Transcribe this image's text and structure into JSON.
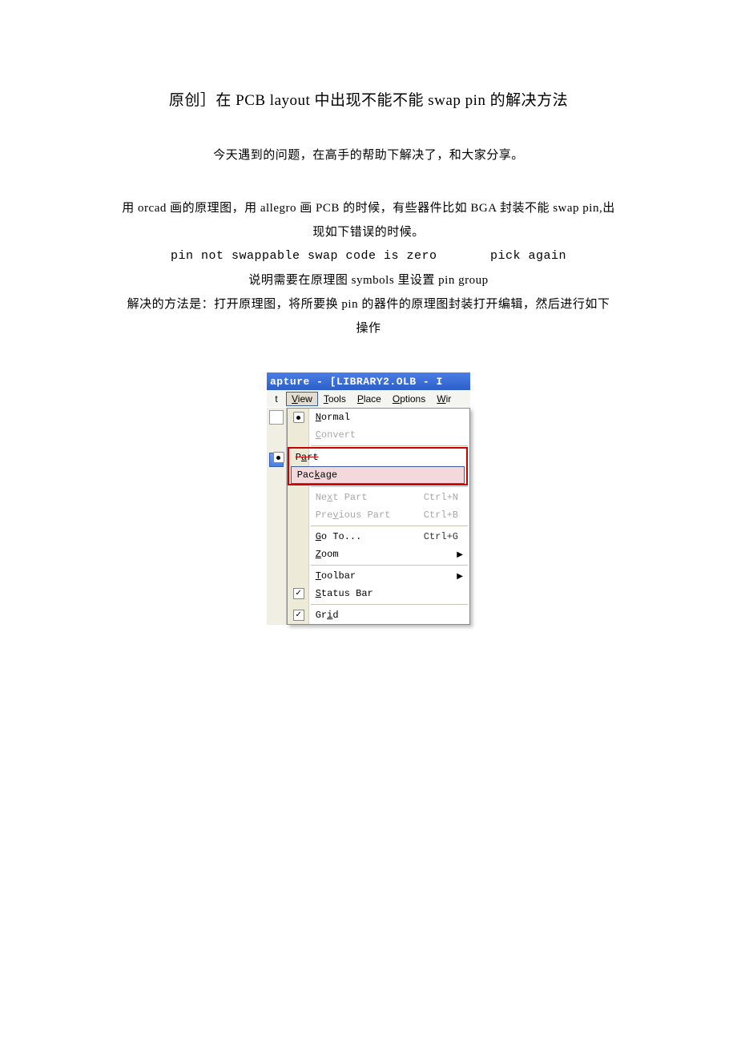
{
  "document": {
    "title": "原创］在 PCB layout 中出现不能不能 swap pin 的解决方法",
    "intro": "今天遇到的问题，在高手的帮助下解决了，和大家分享。",
    "p1_line1": "用 orcad 画的原理图，用 allegro 画 PCB 的时候，有些器件比如 BGA 封装不能 swap pin,出",
    "p1_line2": "现如下错误的时候。",
    "error_text": "pin not swappable swap code is zero       pick again",
    "p2": "说明需要在原理图 symbols 里设置 pin group",
    "p3_line1": "解决的方法是：打开原理图，将所要换 pin 的器件的原理图封装打开编辑，然后进行如下",
    "p3_line2": "操作"
  },
  "screenshot": {
    "titlebar": "apture - [LIBRARY2.OLB - I",
    "menubar": {
      "left": "t",
      "items": [
        "View",
        "Tools",
        "Place",
        "Options",
        "Wir"
      ]
    },
    "menu": {
      "normal": "Normal",
      "convert": "Convert",
      "part": "Part",
      "package": "Package",
      "next_part": "Next Part",
      "next_part_key": "Ctrl+N",
      "prev_part": "Previous Part",
      "prev_part_key": "Ctrl+B",
      "goto": "Go To...",
      "goto_key": "Ctrl+G",
      "zoom": "Zoom",
      "toolbar": "Toolbar",
      "statusbar": "Status Bar",
      "grid": "Grid"
    }
  }
}
